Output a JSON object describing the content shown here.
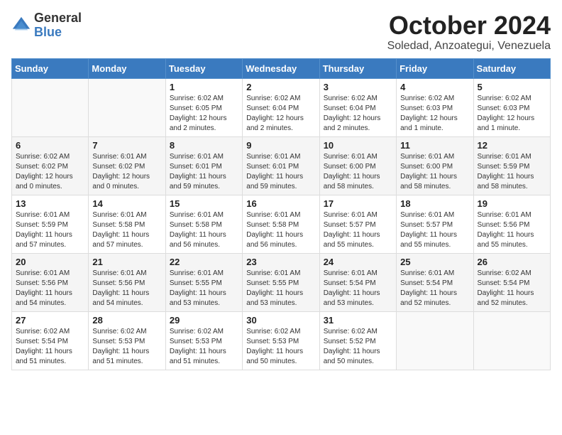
{
  "header": {
    "logo_general": "General",
    "logo_blue": "Blue",
    "month_title": "October 2024",
    "location": "Soledad, Anzoategui, Venezuela"
  },
  "days_of_week": [
    "Sunday",
    "Monday",
    "Tuesday",
    "Wednesday",
    "Thursday",
    "Friday",
    "Saturday"
  ],
  "weeks": [
    [
      {
        "day": "",
        "info": ""
      },
      {
        "day": "",
        "info": ""
      },
      {
        "day": "1",
        "info": "Sunrise: 6:02 AM\nSunset: 6:05 PM\nDaylight: 12 hours and 2 minutes."
      },
      {
        "day": "2",
        "info": "Sunrise: 6:02 AM\nSunset: 6:04 PM\nDaylight: 12 hours and 2 minutes."
      },
      {
        "day": "3",
        "info": "Sunrise: 6:02 AM\nSunset: 6:04 PM\nDaylight: 12 hours and 2 minutes."
      },
      {
        "day": "4",
        "info": "Sunrise: 6:02 AM\nSunset: 6:03 PM\nDaylight: 12 hours and 1 minute."
      },
      {
        "day": "5",
        "info": "Sunrise: 6:02 AM\nSunset: 6:03 PM\nDaylight: 12 hours and 1 minute."
      }
    ],
    [
      {
        "day": "6",
        "info": "Sunrise: 6:02 AM\nSunset: 6:02 PM\nDaylight: 12 hours and 0 minutes."
      },
      {
        "day": "7",
        "info": "Sunrise: 6:01 AM\nSunset: 6:02 PM\nDaylight: 12 hours and 0 minutes."
      },
      {
        "day": "8",
        "info": "Sunrise: 6:01 AM\nSunset: 6:01 PM\nDaylight: 11 hours and 59 minutes."
      },
      {
        "day": "9",
        "info": "Sunrise: 6:01 AM\nSunset: 6:01 PM\nDaylight: 11 hours and 59 minutes."
      },
      {
        "day": "10",
        "info": "Sunrise: 6:01 AM\nSunset: 6:00 PM\nDaylight: 11 hours and 58 minutes."
      },
      {
        "day": "11",
        "info": "Sunrise: 6:01 AM\nSunset: 6:00 PM\nDaylight: 11 hours and 58 minutes."
      },
      {
        "day": "12",
        "info": "Sunrise: 6:01 AM\nSunset: 5:59 PM\nDaylight: 11 hours and 58 minutes."
      }
    ],
    [
      {
        "day": "13",
        "info": "Sunrise: 6:01 AM\nSunset: 5:59 PM\nDaylight: 11 hours and 57 minutes."
      },
      {
        "day": "14",
        "info": "Sunrise: 6:01 AM\nSunset: 5:58 PM\nDaylight: 11 hours and 57 minutes."
      },
      {
        "day": "15",
        "info": "Sunrise: 6:01 AM\nSunset: 5:58 PM\nDaylight: 11 hours and 56 minutes."
      },
      {
        "day": "16",
        "info": "Sunrise: 6:01 AM\nSunset: 5:58 PM\nDaylight: 11 hours and 56 minutes."
      },
      {
        "day": "17",
        "info": "Sunrise: 6:01 AM\nSunset: 5:57 PM\nDaylight: 11 hours and 55 minutes."
      },
      {
        "day": "18",
        "info": "Sunrise: 6:01 AM\nSunset: 5:57 PM\nDaylight: 11 hours and 55 minutes."
      },
      {
        "day": "19",
        "info": "Sunrise: 6:01 AM\nSunset: 5:56 PM\nDaylight: 11 hours and 55 minutes."
      }
    ],
    [
      {
        "day": "20",
        "info": "Sunrise: 6:01 AM\nSunset: 5:56 PM\nDaylight: 11 hours and 54 minutes."
      },
      {
        "day": "21",
        "info": "Sunrise: 6:01 AM\nSunset: 5:56 PM\nDaylight: 11 hours and 54 minutes."
      },
      {
        "day": "22",
        "info": "Sunrise: 6:01 AM\nSunset: 5:55 PM\nDaylight: 11 hours and 53 minutes."
      },
      {
        "day": "23",
        "info": "Sunrise: 6:01 AM\nSunset: 5:55 PM\nDaylight: 11 hours and 53 minutes."
      },
      {
        "day": "24",
        "info": "Sunrise: 6:01 AM\nSunset: 5:54 PM\nDaylight: 11 hours and 53 minutes."
      },
      {
        "day": "25",
        "info": "Sunrise: 6:01 AM\nSunset: 5:54 PM\nDaylight: 11 hours and 52 minutes."
      },
      {
        "day": "26",
        "info": "Sunrise: 6:02 AM\nSunset: 5:54 PM\nDaylight: 11 hours and 52 minutes."
      }
    ],
    [
      {
        "day": "27",
        "info": "Sunrise: 6:02 AM\nSunset: 5:54 PM\nDaylight: 11 hours and 51 minutes."
      },
      {
        "day": "28",
        "info": "Sunrise: 6:02 AM\nSunset: 5:53 PM\nDaylight: 11 hours and 51 minutes."
      },
      {
        "day": "29",
        "info": "Sunrise: 6:02 AM\nSunset: 5:53 PM\nDaylight: 11 hours and 51 minutes."
      },
      {
        "day": "30",
        "info": "Sunrise: 6:02 AM\nSunset: 5:53 PM\nDaylight: 11 hours and 50 minutes."
      },
      {
        "day": "31",
        "info": "Sunrise: 6:02 AM\nSunset: 5:52 PM\nDaylight: 11 hours and 50 minutes."
      },
      {
        "day": "",
        "info": ""
      },
      {
        "day": "",
        "info": ""
      }
    ]
  ]
}
